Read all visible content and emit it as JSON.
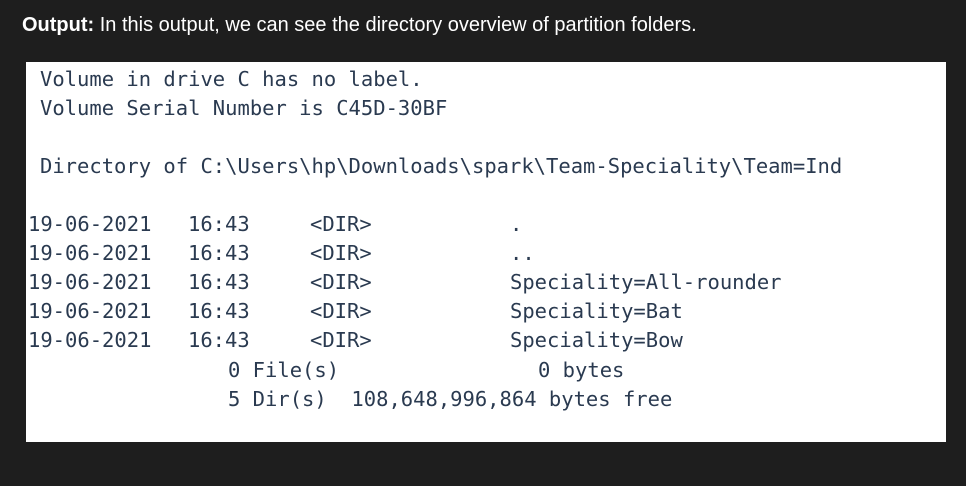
{
  "caption": {
    "label": "Output:",
    "text": " In this output, we can see the directory overview of partition folders."
  },
  "console": {
    "volume_label_line": "Volume in drive C has no label.",
    "serial_line": "Volume Serial Number is C45D-30BF",
    "directory_line": "Directory of C:\\Users\\hp\\Downloads\\spark\\Team-Speciality\\Team=Ind",
    "entries": [
      {
        "date": "19-06-2021",
        "time": "16:43",
        "type": "<DIR>",
        "name": "."
      },
      {
        "date": "19-06-2021",
        "time": "16:43",
        "type": "<DIR>",
        "name": ".."
      },
      {
        "date": "19-06-2021",
        "time": "16:43",
        "type": "<DIR>",
        "name": "Speciality=All-rounder"
      },
      {
        "date": "19-06-2021",
        "time": "16:43",
        "type": "<DIR>",
        "name": "Speciality=Bat"
      },
      {
        "date": "19-06-2021",
        "time": "16:43",
        "type": "<DIR>",
        "name": "Speciality=Bow"
      }
    ],
    "files_summary": "0 File(s)",
    "files_bytes": "0 bytes",
    "dirs_summary": "5 Dir(s)  108,648,996,864 bytes free"
  }
}
